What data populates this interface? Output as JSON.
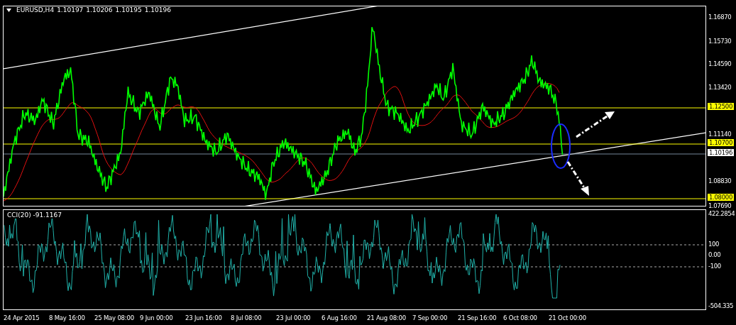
{
  "chart": {
    "symbol": "EURUSD,H4",
    "quotes": [
      "1.10197",
      "1.10206",
      "1.10195",
      "1.10196"
    ],
    "price_scale": [
      "1.16870",
      "1.15730",
      "1.14590",
      "1.13420",
      "1.11140",
      "1.08830",
      "1.07690"
    ],
    "levels": [
      {
        "kind": "level",
        "label": "1.12500"
      },
      {
        "kind": "level",
        "label": "1.10700"
      },
      {
        "kind": "bid",
        "label": "1.10196"
      },
      {
        "kind": "level",
        "label": "1.08000"
      }
    ]
  },
  "indicator": {
    "title": "CCI(20) -91.1167",
    "scale": [
      "422.2854",
      "100",
      "0.00",
      "-100",
      "-504.335"
    ]
  },
  "time_axis": [
    "24 Apr 2015",
    "8 May 16:00",
    "25 May 08:00",
    "9 Jun 00:00",
    "23 Jun 16:00",
    "8 Jul 08:00",
    "23 Jul 00:00",
    "6 Aug 16:00",
    "21 Aug 08:00",
    "7 Sep 00:00",
    "21 Sep 16:00",
    "6 Oct 08:00",
    "21 Oct 00:00"
  ]
}
